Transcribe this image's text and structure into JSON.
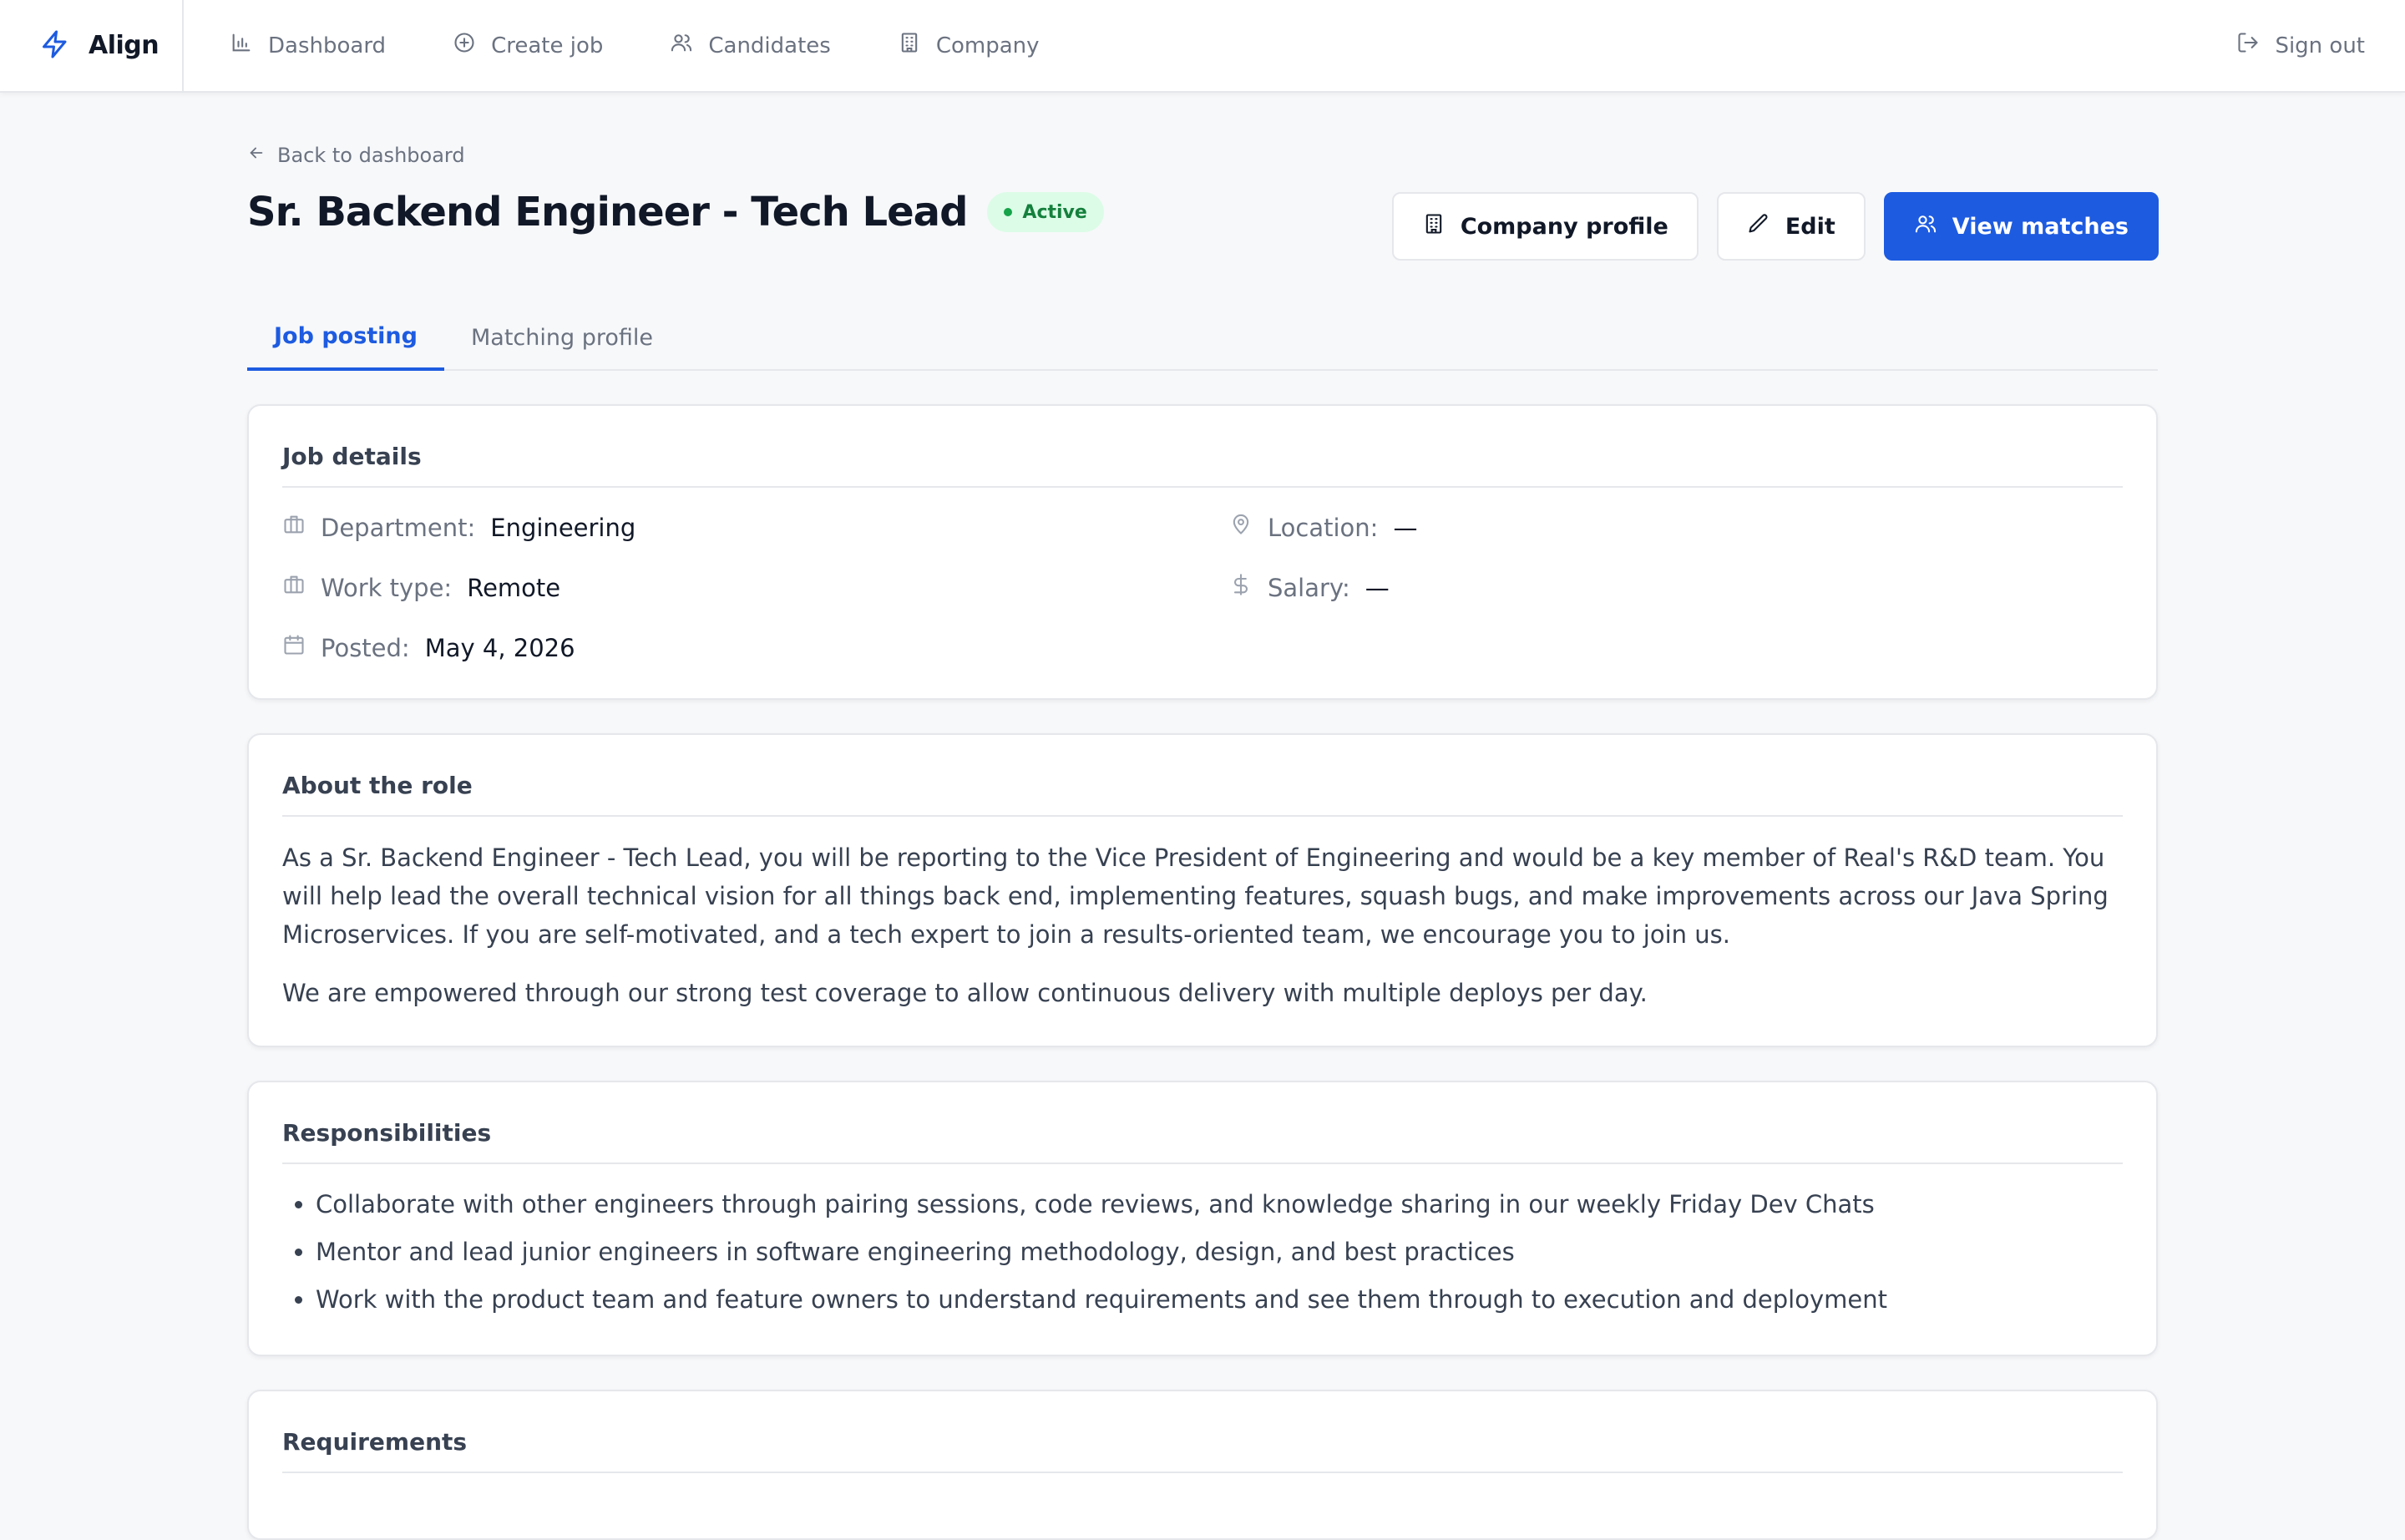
{
  "app": {
    "name": "Align",
    "accent": "#1d5be0"
  },
  "nav": {
    "items": [
      {
        "label": "Dashboard",
        "icon": "bar-chart-icon"
      },
      {
        "label": "Create job",
        "icon": "plus-circle-icon"
      },
      {
        "label": "Candidates",
        "icon": "users-icon"
      },
      {
        "label": "Company",
        "icon": "building-icon"
      }
    ],
    "sign_out": "Sign out"
  },
  "header": {
    "back_label": "Back to dashboard",
    "title": "Sr. Backend Engineer - Tech Lead",
    "status": "Active",
    "actions": {
      "company_profile": "Company profile",
      "edit": "Edit",
      "view_matches": "View matches"
    }
  },
  "tabs": [
    {
      "label": "Job posting",
      "active": true
    },
    {
      "label": "Matching profile",
      "active": false
    }
  ],
  "job_details": {
    "title": "Job details",
    "department": {
      "label": "Department:",
      "value": "Engineering"
    },
    "location": {
      "label": "Location:",
      "value": "—"
    },
    "work_type": {
      "label": "Work type:",
      "value": "Remote"
    },
    "salary": {
      "label": "Salary:",
      "value": "—"
    },
    "posted": {
      "label": "Posted:",
      "value": "May 4, 2026"
    }
  },
  "about": {
    "title": "About the role",
    "paragraphs": [
      "As a Sr. Backend Engineer - Tech Lead, you will be reporting to the Vice President of Engineering and would be a key member of Real's R&D team. You will help lead the overall technical vision for all things back end, implementing features, squash bugs, and make improvements across our Java Spring Microservices. If you are self-motivated, and a tech expert to join a results-oriented team, we encourage you to join us.",
      "We are empowered through our strong test coverage to allow continuous delivery with multiple deploys per day."
    ]
  },
  "responsibilities": {
    "title": "Responsibilities",
    "items": [
      "Collaborate with other engineers through pairing sessions, code reviews, and knowledge sharing in our weekly Friday Dev Chats",
      "Mentor and lead junior engineers in software engineering methodology, design, and best practices",
      "Work with the product team and feature owners to understand requirements and see them through to execution and deployment"
    ]
  },
  "requirements": {
    "title": "Requirements"
  }
}
